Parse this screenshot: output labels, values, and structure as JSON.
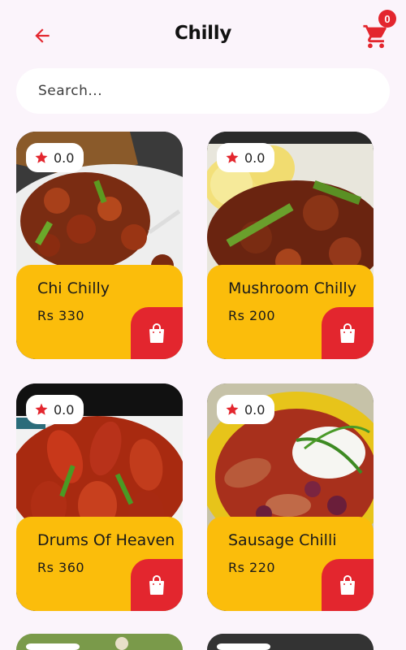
{
  "header": {
    "title": "Chilly",
    "cart_count": "0"
  },
  "search": {
    "placeholder": "Search..."
  },
  "products": [
    {
      "name": "Chi Chilly",
      "price": "Rs 330",
      "rating": "0.0"
    },
    {
      "name": "Mushroom Chilly",
      "price": "Rs 200",
      "rating": "0.0"
    },
    {
      "name": "Drums Of Heaven",
      "price": "Rs 360",
      "rating": "0.0"
    },
    {
      "name": "Sausage Chilli",
      "price": "Rs 220",
      "rating": "0.0"
    }
  ],
  "colors": {
    "accent": "#e3262e",
    "card": "#fbbd0b",
    "background": "#fbf4fb"
  },
  "icons": {
    "back": "arrow-left-icon",
    "cart": "cart-icon",
    "star": "star-icon",
    "bag": "shopping-bag-icon"
  }
}
